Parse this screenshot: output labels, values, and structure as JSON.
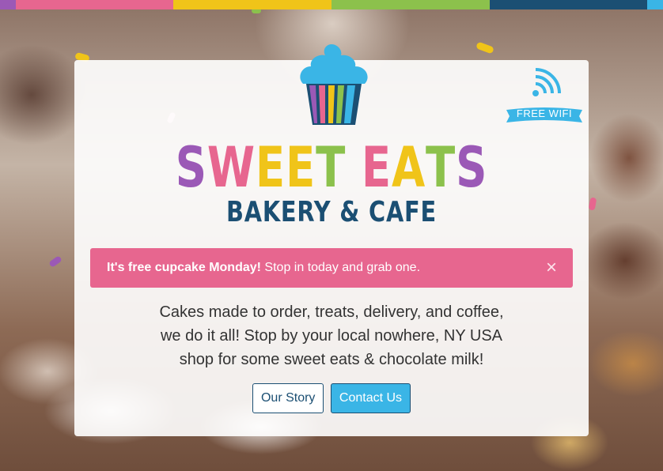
{
  "colors": {
    "bar": [
      "#9b59b6",
      "#e7668f",
      "#f0c419",
      "#8cc14c",
      "#1b4f73",
      "#3ab5e6"
    ],
    "brand_letters": [
      "#9b59b6",
      "#e7668f",
      "#f0c419",
      "#f0c419",
      "#8cc14c",
      "#e7668f",
      "#f0c419",
      "#8cc14c",
      "#9b59b6"
    ],
    "alert_bg": "#e7668f",
    "accent": "#3ab5e6",
    "navy": "#1b4f73"
  },
  "logo": {
    "icon": "cupcake-icon",
    "title_letters": [
      "S",
      "W",
      "E",
      "E",
      "T",
      " ",
      "E",
      "A",
      "T",
      "S"
    ],
    "subtitle": "BAKERY & CAFE"
  },
  "wifi": {
    "icon": "wifi-icon",
    "label": "FREE WIFI"
  },
  "alert": {
    "bold": "It's free cupcake Monday!",
    "text": " Stop in today and grab one.",
    "close": "×"
  },
  "lead": {
    "line1": "Cakes made to order, treats, delivery, and coffee,",
    "line2": "we do it all! Stop by your local nowhere, NY USA",
    "line3": "shop for some sweet eats & chocolate milk!"
  },
  "buttons": {
    "story": "Our Story",
    "contact": "Contact Us"
  }
}
